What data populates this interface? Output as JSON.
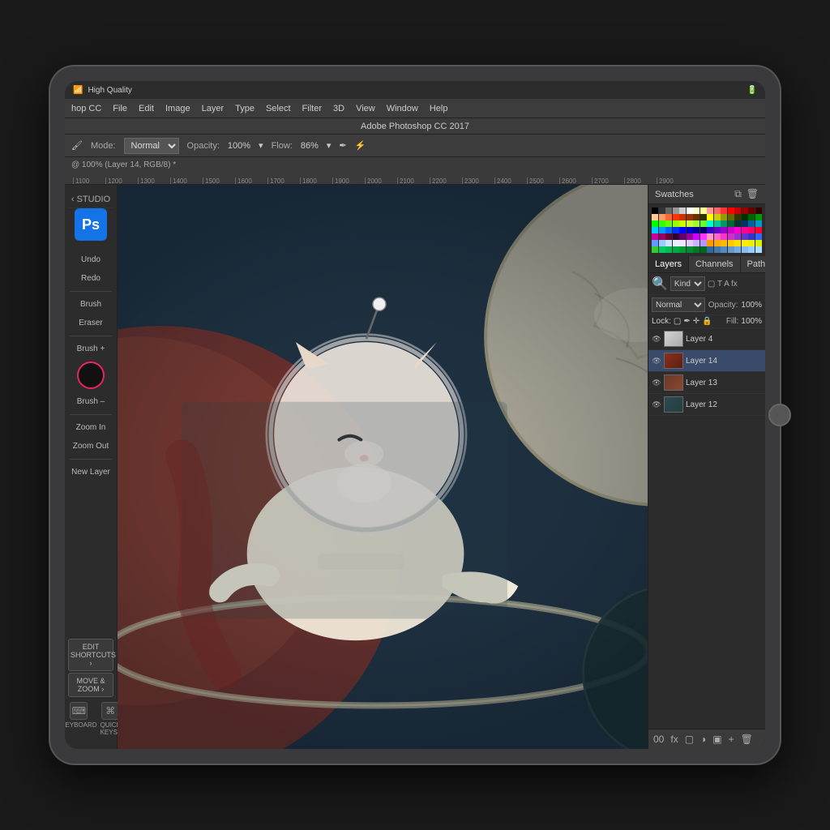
{
  "device": {
    "type": "iPad Pro",
    "corner_radius": 30
  },
  "system_bar": {
    "left": "High Quality",
    "wifi_icon": "wifi",
    "right_items": [
      "battery",
      "signal"
    ]
  },
  "app": {
    "name": "Adobe Photoshop CC 2017",
    "title": "Adobe Photoshop CC 2017",
    "file_info": "@ 100% (Layer 14, RGB/8) *"
  },
  "menu_bar": {
    "app_label": "hop CC",
    "items": [
      "File",
      "Edit",
      "Image",
      "Layer",
      "Type",
      "Select",
      "Filter",
      "3D",
      "View",
      "Window",
      "Help"
    ]
  },
  "options_bar": {
    "mode_label": "Mode:",
    "mode_value": "Normal",
    "opacity_label": "Opacity:",
    "opacity_value": "100%",
    "flow_label": "Flow:",
    "flow_value": "86%"
  },
  "ruler": {
    "marks": [
      "1100",
      "1200",
      "1300",
      "1400",
      "1500",
      "1600",
      "1700",
      "1800",
      "1900",
      "2000",
      "2100",
      "2200",
      "2300",
      "2400",
      "2500",
      "2600",
      "2700",
      "2800",
      "2900"
    ]
  },
  "left_sidebar": {
    "studio_label": "‹ STUDIO",
    "buttons": [
      "Undo",
      "Redo",
      "Brush",
      "Eraser",
      "Brush +",
      "Brush –",
      "Zoom In",
      "Zoom Out",
      "New Layer"
    ],
    "edit_shortcuts": "EDIT SHORTCUTS ›",
    "move_zoom": "MOVE & ZOOM ›",
    "bottom_icons": [
      {
        "label": "KEYBOARD",
        "icon": "⌨"
      },
      {
        "label": "QUICK KEYS",
        "icon": "⌘"
      }
    ]
  },
  "swatches_panel": {
    "title": "Swatches",
    "icon_copy": "⧉",
    "icon_delete": "🗑",
    "colors": [
      "#000000",
      "#333333",
      "#666666",
      "#999999",
      "#cccccc",
      "#ffffff",
      "#ffffcc",
      "#ffff99",
      "#ff9999",
      "#ff6666",
      "#ff3333",
      "#ff0000",
      "#cc0000",
      "#990000",
      "#660000",
      "#330000",
      "#ffcc99",
      "#ff9966",
      "#ff6633",
      "#ff3300",
      "#cc3300",
      "#993300",
      "#663300",
      "#333300",
      "#ffff00",
      "#cccc00",
      "#999900",
      "#666600",
      "#333600",
      "#003300",
      "#006600",
      "#009900",
      "#00ff00",
      "#33ff00",
      "#66ff00",
      "#99ff00",
      "#ccff00",
      "#ccff33",
      "#99ff33",
      "#66ff33",
      "#00ffcc",
      "#00cc99",
      "#009966",
      "#006633",
      "#003333",
      "#003366",
      "#006699",
      "#0099cc",
      "#00ccff",
      "#0099ff",
      "#0066ff",
      "#0033ff",
      "#0000ff",
      "#0000cc",
      "#000099",
      "#000066",
      "#3300cc",
      "#6600cc",
      "#9900cc",
      "#cc00cc",
      "#ff00cc",
      "#ff0099",
      "#ff0066",
      "#ff0033",
      "#cc0099",
      "#990066",
      "#660033",
      "#330033",
      "#660066",
      "#990099",
      "#cc00ff",
      "#ff33ff",
      "#ff99cc",
      "#ff66cc",
      "#ff33cc",
      "#cc33cc",
      "#9933cc",
      "#6633cc",
      "#3333cc",
      "#3366ff",
      "#6699ff",
      "#99ccff",
      "#cce5ff",
      "#e5f0ff",
      "#f0e5ff",
      "#e5ccff",
      "#ccb3ff",
      "#b399ff",
      "#ff9900",
      "#ffaa00",
      "#ffbb00",
      "#ffcc00",
      "#ffdd00",
      "#ffee00",
      "#eeee00",
      "#ddee00",
      "#33cc33",
      "#00cc66",
      "#00bb55",
      "#00aa44",
      "#009933",
      "#008833",
      "#007722",
      "#006622",
      "#336699",
      "#4477aa",
      "#5588bb",
      "#6699cc",
      "#77aadd",
      "#88bbee",
      "#99ccff",
      "#aaddff"
    ]
  },
  "layers_panel": {
    "tabs": [
      "Layers",
      "Channels",
      "Paths"
    ],
    "active_tab": "Layers",
    "search_placeholder": "Kind",
    "blend_mode": "Normal",
    "opacity_label": "Opacity:",
    "opacity_value": "100%",
    "lock_label": "Lock:",
    "fill_label": "Fill:",
    "fill_value": "100%",
    "layers": [
      {
        "name": "Layer 4",
        "visible": true,
        "active": false,
        "thumb_color": "#cccccc"
      },
      {
        "name": "Layer 14",
        "visible": true,
        "active": true,
        "thumb_color": "#8b4040"
      },
      {
        "name": "Layer 13",
        "visible": true,
        "active": false,
        "thumb_color": "#704040"
      },
      {
        "name": "Layer 12",
        "visible": true,
        "active": false,
        "thumb_color": "#506060"
      }
    ],
    "footer_icons": [
      "00",
      "fx",
      "▢",
      "▤",
      "▣",
      "🗑"
    ]
  }
}
